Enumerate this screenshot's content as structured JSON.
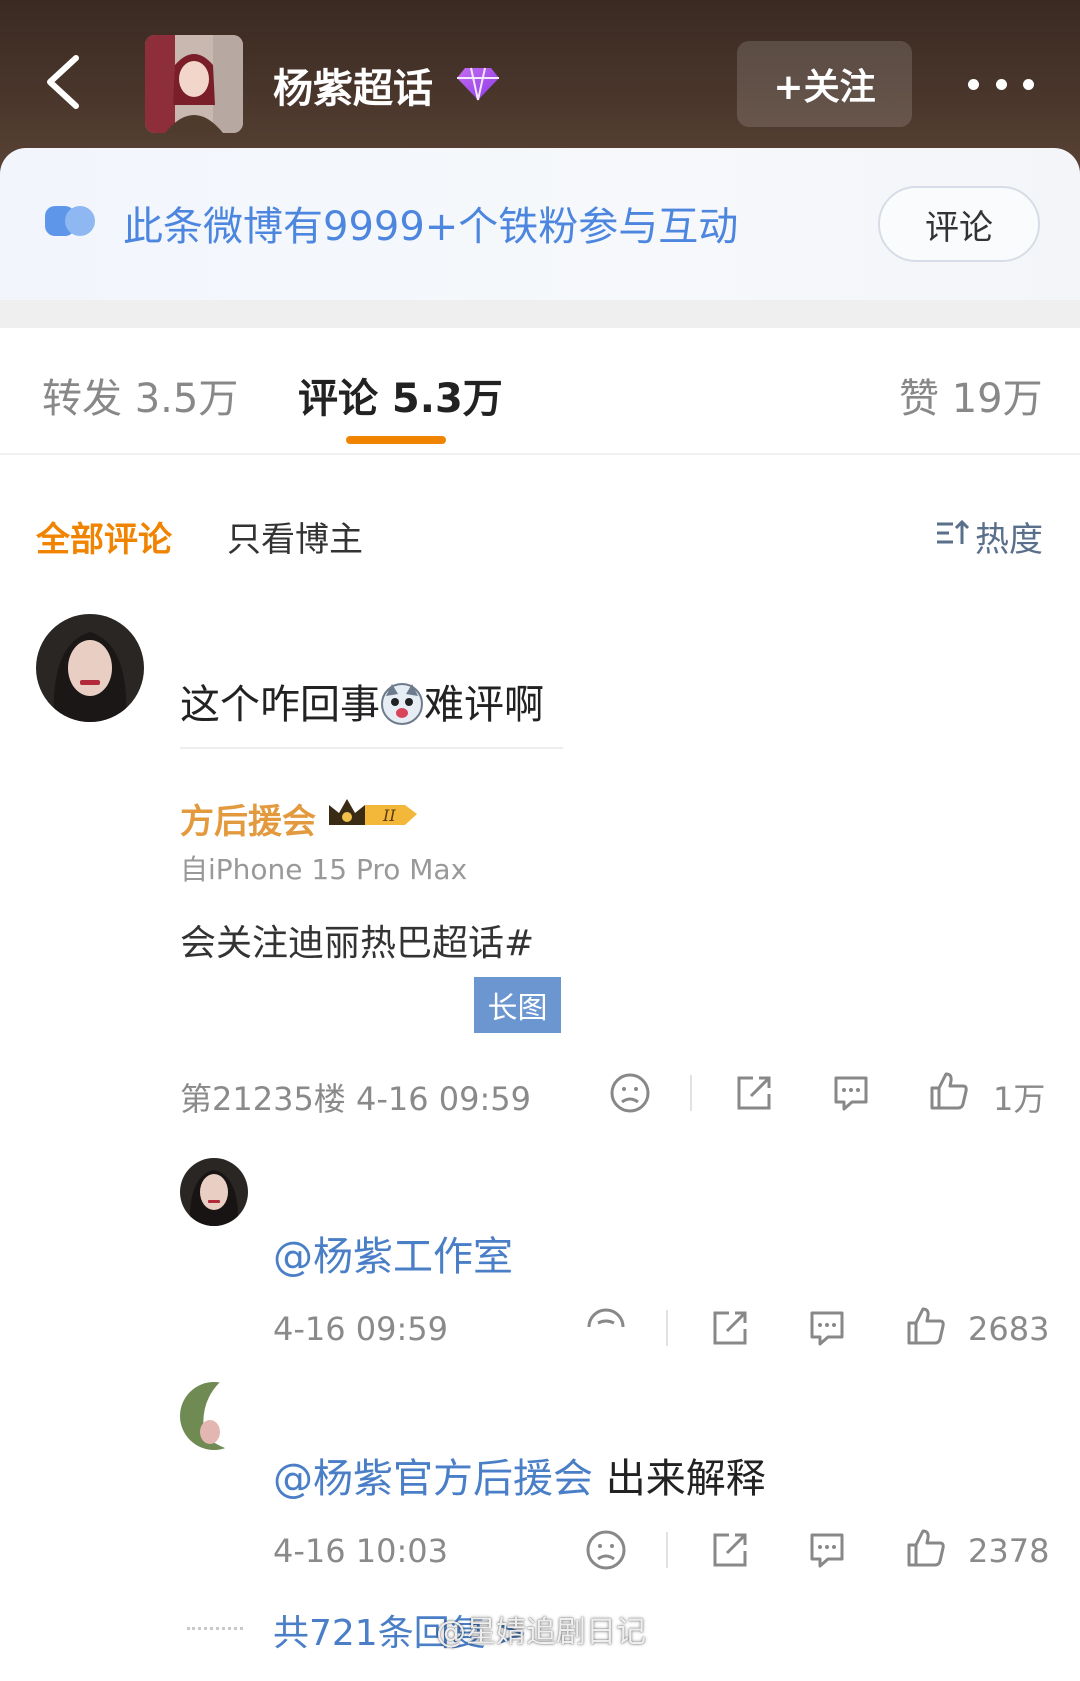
{
  "header": {
    "back_icon": "chevron-left-icon",
    "title": "杨紫超话",
    "badge_icon": "gem-icon",
    "follow_label": "+关注",
    "more_icon": "more-dots-icon"
  },
  "banner": {
    "text": "此条微博有9999+个铁粉参与互动",
    "button_label": "评论",
    "accent_color": "#4d86df"
  },
  "tabs": {
    "repost": "转发 3.5万",
    "comments": "评论 5.3万",
    "likes": "赞 19万"
  },
  "filters": {
    "all": "全部评论",
    "author_only": "只看博主",
    "sort": "热度"
  },
  "comment": {
    "text_before": "这个咋回事",
    "text_after": "难评啊",
    "quoted_fan_name": "方后援会",
    "quoted_device": "自iPhone 15 Pro Max",
    "quoted_hashtag": "会关注迪丽热巴超话#",
    "long_image_label": "长图",
    "floor_time": "第21235楼 4-16 09:59",
    "like_count": "1万"
  },
  "replies": [
    {
      "mention": "@杨紫工作室",
      "text": "",
      "time": "4-16 09:59",
      "like_count": "2683"
    },
    {
      "mention": "@杨紫官方后援会",
      "text": " 出来解释",
      "time": "4-16 10:03",
      "like_count": "2378"
    }
  ],
  "more_replies_label": "共721条回复 >",
  "watermark": "@星婧追剧日记"
}
